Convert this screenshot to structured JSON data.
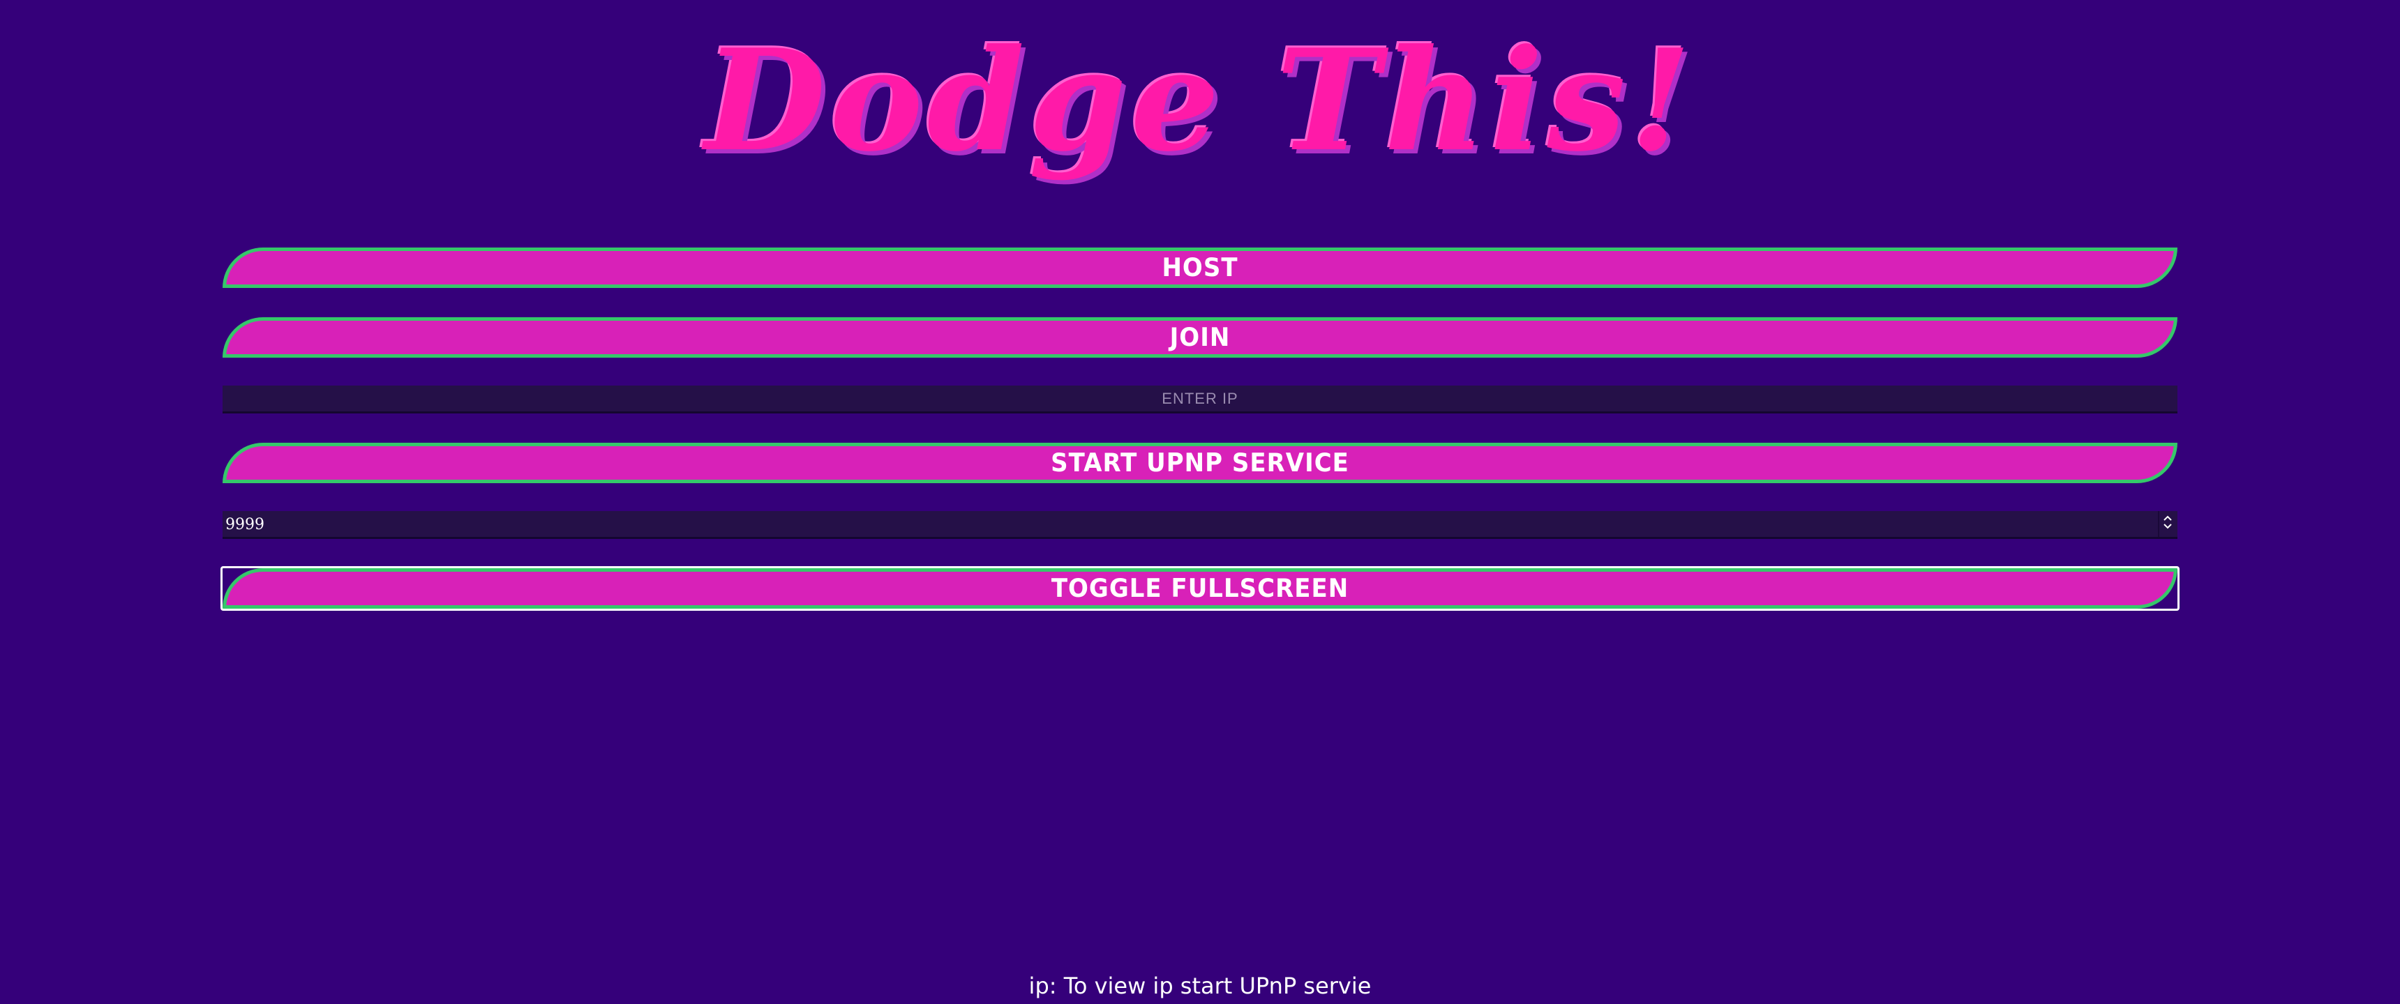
{
  "title": "Dodge This!",
  "menu": {
    "host_label": "HOST",
    "join_label": "JOIN",
    "ip_placeholder": "ENTER IP",
    "upnp_label": "START UPNP SERVICE",
    "port_value": "9999",
    "fullscreen_label": "TOGGLE FULLSCREEN"
  },
  "icons": {
    "spinner": "updown-spinner-icon"
  },
  "colors": {
    "background": "#35007a",
    "button_fill": "#d821b8",
    "button_border": "#35c86a",
    "title": "#ff1aa8",
    "input_bg": "#251048"
  },
  "status": {
    "text": "ip: To view ip start UPnP servie"
  }
}
